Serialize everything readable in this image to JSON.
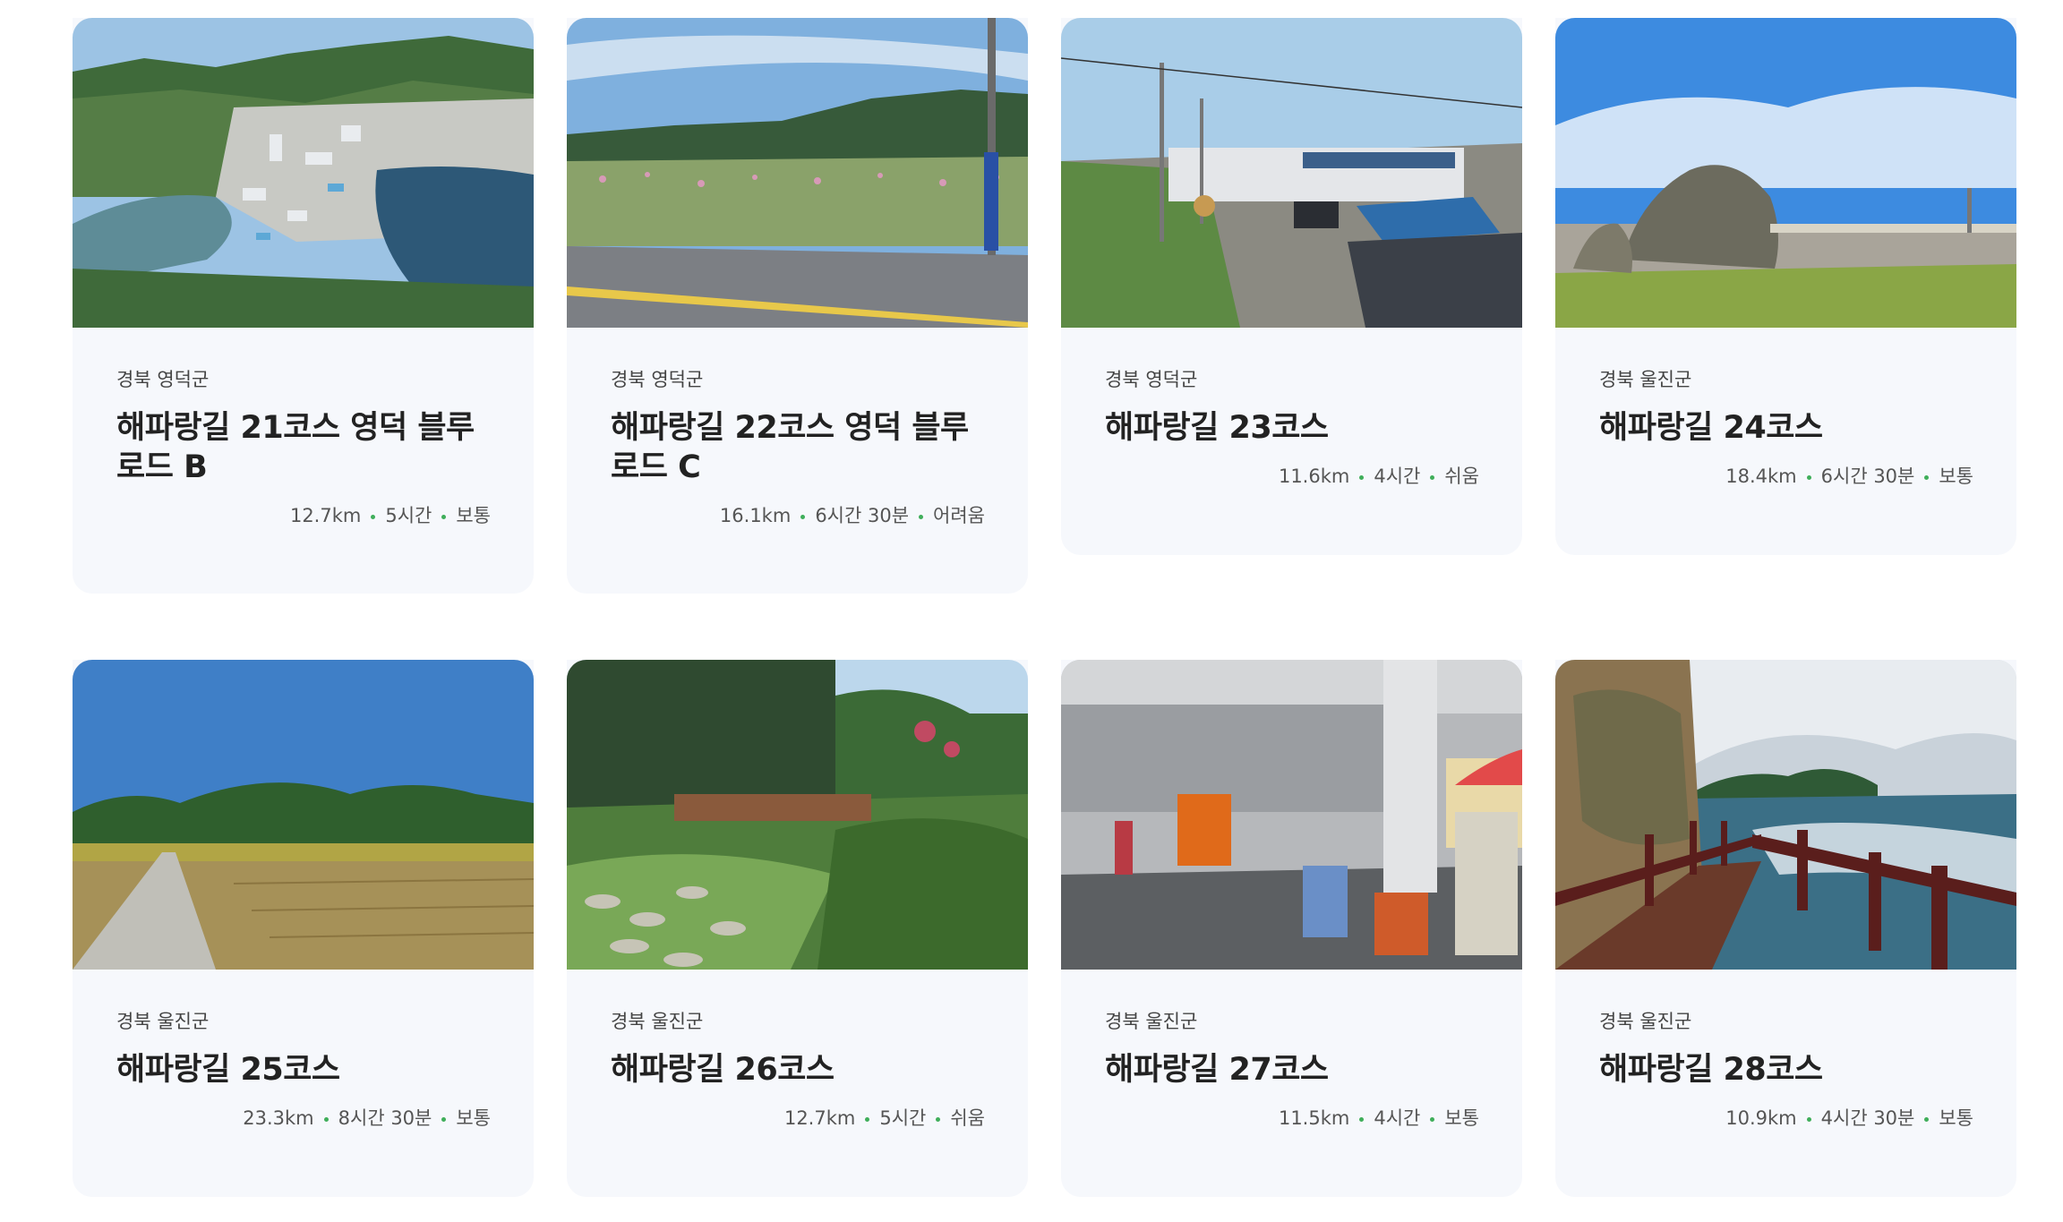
{
  "courses": [
    {
      "region": "경북 영덕군",
      "title": "해파랑길 21코스 영덕 블루로드 B",
      "distance": "12.7km",
      "time": "5시간",
      "level": "보통"
    },
    {
      "region": "경북 영덕군",
      "title": "해파랑길 22코스 영덕 블루로드 C",
      "distance": "16.1km",
      "time": "6시간 30분",
      "level": "어려움"
    },
    {
      "region": "경북 영덕군",
      "title": "해파랑길 23코스",
      "distance": "11.6km",
      "time": "4시간",
      "level": "쉬움"
    },
    {
      "region": "경북 울진군",
      "title": "해파랑길 24코스",
      "distance": "18.4km",
      "time": "6시간 30분",
      "level": "보통"
    },
    {
      "region": "경북 울진군",
      "title": "해파랑길 25코스",
      "distance": "23.3km",
      "time": "8시간 30분",
      "level": "보통"
    },
    {
      "region": "경북 울진군",
      "title": "해파랑길 26코스",
      "distance": "12.7km",
      "time": "5시간",
      "level": "쉬움"
    },
    {
      "region": "경북 울진군",
      "title": "해파랑길 27코스",
      "distance": "11.5km",
      "time": "4시간",
      "level": "보통"
    },
    {
      "region": "경북 울진군",
      "title": "해파랑길 28코스",
      "distance": "10.9km",
      "time": "4시간 30분",
      "level": "보통"
    }
  ],
  "colors": {
    "card_bg": "#f6f8fc",
    "meta_dot": "#3fae5a"
  }
}
